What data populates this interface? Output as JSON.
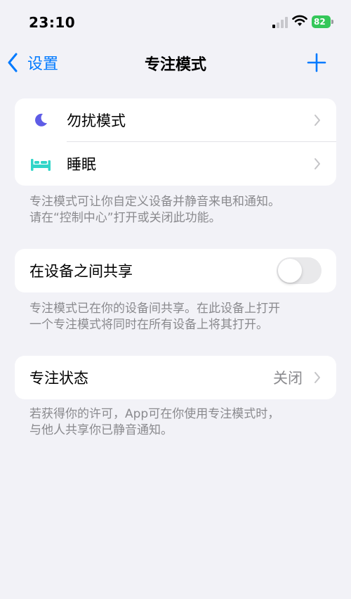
{
  "status_bar": {
    "time": "23:10",
    "battery": "82"
  },
  "nav": {
    "back_label": "设置",
    "title": "专注模式"
  },
  "focus_list": [
    {
      "label": "勿扰模式",
      "icon": "moon-icon",
      "icon_color": "#5E5CE6"
    },
    {
      "label": "睡眠",
      "icon": "bed-icon",
      "icon_color": "#30D5C8"
    }
  ],
  "focus_footnote": "专注模式可让你自定义设备并静音来电和通知。\n请在“控制中心”打开或关闭此功能。",
  "share": {
    "label": "在设备之间共享",
    "enabled": false
  },
  "share_footnote": "专注模式已在你的设备间共享。在此设备上打开\n一个专注模式将同时在所有设备上将其打开。",
  "status": {
    "label": "专注状态",
    "value": "关闭"
  },
  "status_footnote": "若获得你的许可，App可在你使用专注模式时，\n与他人共享你已静音通知。",
  "colors": {
    "accent": "#007AFF",
    "battery": "#34C759",
    "background": "#F2F2F7"
  }
}
